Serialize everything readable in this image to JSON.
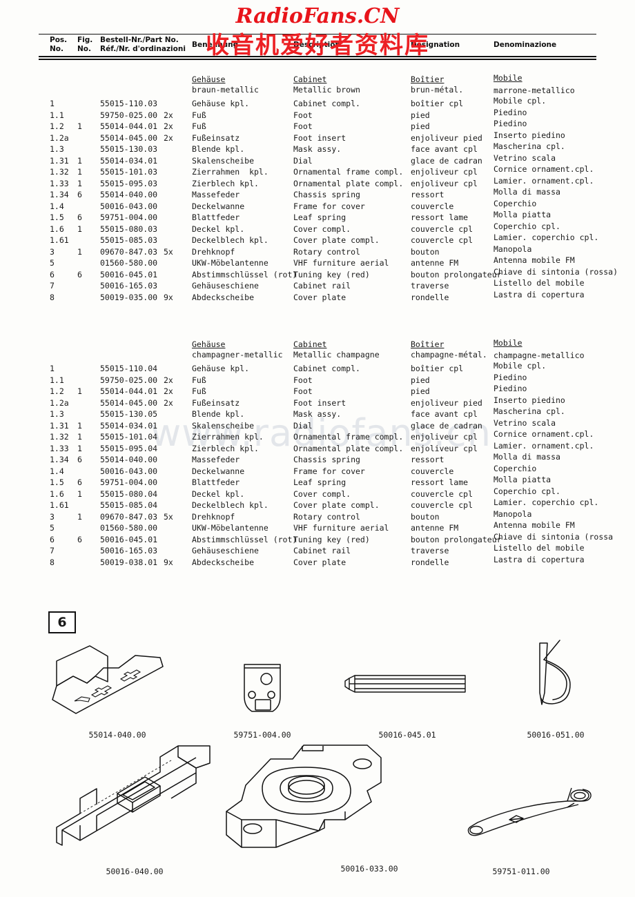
{
  "watermarks": {
    "logo": "RadioFans.CN",
    "logo_cjk": "收音机爱好者资料库",
    "mid": "www.radiofans.cn",
    "logo_color": "#e8141a"
  },
  "header": {
    "pos_l1": "Pos.",
    "pos_l2": "No.",
    "fig_l1": "Fig.",
    "fig_l2": "No.",
    "part_l1": "Bestell-Nr./Part No.",
    "part_l2": "Réf./Nr. d'ordinazioni",
    "de": "Benennung",
    "en": "Description",
    "fr": "Designation",
    "it": "Denominazione"
  },
  "sections": [
    {
      "group": {
        "de_title": "Gehäuse",
        "de_sub": "braun-metallic",
        "en_title": "Cabinet",
        "en_sub": "Metallic brown",
        "fr_title": "Boîtier",
        "fr_sub": "brun-métal.",
        "it_title": "Mobile",
        "it_sub": "marrone-metallico"
      },
      "rows": [
        {
          "pos": "1",
          "fig": "",
          "part": "55015-110.03",
          "qty": "",
          "de": "Gehäuse kpl.",
          "en": "Cabinet compl.",
          "fr": "boîtier cpl",
          "it": "Mobile cpl."
        },
        {
          "pos": "1.1",
          "fig": "",
          "part": "59750-025.00",
          "qty": "2x",
          "de": "Fuß",
          "en": "Foot",
          "fr": "pied",
          "it": "Piedino"
        },
        {
          "pos": "1.2",
          "fig": "1",
          "part": "55014-044.01",
          "qty": "2x",
          "de": "Fuß",
          "en": "Foot",
          "fr": "pied",
          "it": "Piedino"
        },
        {
          "pos": "1.2a",
          "fig": "",
          "part": "55014-045.00",
          "qty": "2x",
          "de": "Fußeinsatz",
          "en": "Foot insert",
          "fr": "enjoliveur pied",
          "it": "Inserto piedino"
        },
        {
          "pos": "1.3",
          "fig": "",
          "part": "55015-130.03",
          "qty": "",
          "de": "Blende kpl.",
          "en": "Mask assy.",
          "fr": "face avant cpl",
          "it": "Mascherina cpl."
        },
        {
          "pos": "1.31",
          "fig": "1",
          "part": "55014-034.01",
          "qty": "",
          "de": "Skalenscheibe",
          "en": "Dial",
          "fr": "glace de cadran",
          "it": "Vetrino scala"
        },
        {
          "pos": "1.32",
          "fig": "1",
          "part": "55015-101.03",
          "qty": "",
          "de": "Zierrahmen  kpl.",
          "en": "Ornamental frame compl.",
          "fr": "enjoliveur cpl",
          "it": "Cornice ornament.cpl."
        },
        {
          "pos": "1.33",
          "fig": "1",
          "part": "55015-095.03",
          "qty": "",
          "de": "Zierblech kpl.",
          "en": "Ornamental plate compl.",
          "fr": "enjoliveur cpl",
          "it": "Lamier. ornament.cpl."
        },
        {
          "pos": "1.34",
          "fig": "6",
          "part": "55014-040.00",
          "qty": "",
          "de": "Massefeder",
          "en": "Chassis spring",
          "fr": "ressort",
          "it": "Molla di massa"
        },
        {
          "pos": "1.4",
          "fig": "",
          "part": "50016-043.00",
          "qty": "",
          "de": "Deckelwanne",
          "en": "Frame for cover",
          "fr": "couvercle",
          "it": "Coperchio"
        },
        {
          "pos": "1.5",
          "fig": "6",
          "part": "59751-004.00",
          "qty": "",
          "de": "Blattfeder",
          "en": "Leaf spring",
          "fr": "ressort lame",
          "it": "Molla piatta"
        },
        {
          "pos": "1.6",
          "fig": "1",
          "part": "55015-080.03",
          "qty": "",
          "de": "Deckel kpl.",
          "en": "Cover compl.",
          "fr": "couvercle cpl",
          "it": "Coperchio cpl."
        },
        {
          "pos": "1.61",
          "fig": "",
          "part": "55015-085.03",
          "qty": "",
          "de": "Deckelblech kpl.",
          "en": "Cover plate compl.",
          "fr": "couvercle cpl",
          "it": "Lamier. coperchio cpl."
        },
        {
          "pos": "3",
          "fig": "1",
          "part": "09670-847.03",
          "qty": "5x",
          "de": "Drehknopf",
          "en": "Rotary control",
          "fr": "bouton",
          "it": "Manopola"
        },
        {
          "pos": "5",
          "fig": "",
          "part": "01560-580.00",
          "qty": "",
          "de": "UKW-Möbelantenne",
          "en": "VHF furniture aerial",
          "fr": "antenne FM",
          "it": "Antenna mobile FM"
        },
        {
          "pos": "6",
          "fig": "6",
          "part": "50016-045.01",
          "qty": "",
          "de": "Abstimmschlüssel (rot)",
          "en": "Tuning key (red)",
          "fr": "bouton prolongateur",
          "it": "Chiave di sintonia (rossa)"
        },
        {
          "pos": "7",
          "fig": "",
          "part": "50016-165.03",
          "qty": "",
          "de": "Gehäuseschiene",
          "en": "Cabinet rail",
          "fr": "traverse",
          "it": "Listello del mobile"
        },
        {
          "pos": "8",
          "fig": "",
          "part": "50019-035.00",
          "qty": "9x",
          "de": "Abdeckscheibe",
          "en": "Cover plate",
          "fr": "rondelle",
          "it": "Lastra di copertura"
        }
      ]
    },
    {
      "group": {
        "de_title": "Gehäuse",
        "de_sub": "champagner-metallic",
        "en_title": "Cabinet",
        "en_sub": "Metallic champagne",
        "fr_title": "Boîtier",
        "fr_sub": "champagne-métal.",
        "it_title": "Mobile",
        "it_sub": "champagne-metallico"
      },
      "rows": [
        {
          "pos": "1",
          "fig": "",
          "part": "55015-110.04",
          "qty": "",
          "de": "Gehäuse kpl.",
          "en": "Cabinet compl.",
          "fr": "boîtier cpl",
          "it": "Mobile cpl."
        },
        {
          "pos": "1.1",
          "fig": "",
          "part": "59750-025.00",
          "qty": "2x",
          "de": "Fuß",
          "en": "Foot",
          "fr": "pied",
          "it": "Piedino"
        },
        {
          "pos": "1.2",
          "fig": "1",
          "part": "55014-044.01",
          "qty": "2x",
          "de": "Fuß",
          "en": "Foot",
          "fr": "pied",
          "it": "Piedino"
        },
        {
          "pos": "1.2a",
          "fig": "",
          "part": "55014-045.00",
          "qty": "2x",
          "de": "Fußeinsatz",
          "en": "Foot insert",
          "fr": "enjoliveur pied",
          "it": "Inserto piedino"
        },
        {
          "pos": "1.3",
          "fig": "",
          "part": "55015-130.05",
          "qty": "",
          "de": "Blende kpl.",
          "en": "Mask assy.",
          "fr": "face avant cpl",
          "it": "Mascherina cpl."
        },
        {
          "pos": "1.31",
          "fig": "1",
          "part": "55014-034.01",
          "qty": "",
          "de": "Skalenscheibe",
          "en": "Dial",
          "fr": "glace de cadran",
          "it": "Vetrino scala"
        },
        {
          "pos": "1.32",
          "fig": "1",
          "part": "55015-101.04",
          "qty": "",
          "de": "Zierrahmen kpl.",
          "en": "Ornamental frame compl.",
          "fr": "enjoliveur cpl",
          "it": "Cornice ornament.cpl."
        },
        {
          "pos": "1.33",
          "fig": "1",
          "part": "55015-095.04",
          "qty": "",
          "de": "Zierblech kpl.",
          "en": "Ornamental plate compl.",
          "fr": "enjoliveur cpl",
          "it": "Lamier. ornament.cpl."
        },
        {
          "pos": "1.34",
          "fig": "6",
          "part": "55014-040.00",
          "qty": "",
          "de": "Massefeder",
          "en": "Chassis spring",
          "fr": "ressort",
          "it": "Molla di massa"
        },
        {
          "pos": "1.4",
          "fig": "",
          "part": "50016-043.00",
          "qty": "",
          "de": "Deckelwanne",
          "en": "Frame for cover",
          "fr": "couvercle",
          "it": "Coperchio"
        },
        {
          "pos": "1.5",
          "fig": "6",
          "part": "59751-004.00",
          "qty": "",
          "de": "Blattfeder",
          "en": "Leaf spring",
          "fr": "ressort lame",
          "it": "Molla piatta"
        },
        {
          "pos": "1.6",
          "fig": "1",
          "part": "55015-080.04",
          "qty": "",
          "de": "Deckel kpl.",
          "en": "Cover compl.",
          "fr": "couvercle cpl",
          "it": "Coperchio cpl."
        },
        {
          "pos": "1.61",
          "fig": "",
          "part": "55015-085.04",
          "qty": "",
          "de": "Deckelblech kpl.",
          "en": "Cover plate compl.",
          "fr": "couvercle cpl",
          "it": "Lamier. coperchio cpl."
        },
        {
          "pos": "3",
          "fig": "1",
          "part": "09670-847.03",
          "qty": "5x",
          "de": "Drehknopf",
          "en": "Rotary control",
          "fr": "bouton",
          "it": "Manopola"
        },
        {
          "pos": "5",
          "fig": "",
          "part": "01560-580.00",
          "qty": "",
          "de": "UKW-Möbelantenne",
          "en": "VHF furniture aerial",
          "fr": "antenne FM",
          "it": "Antenna mobile FM"
        },
        {
          "pos": "6",
          "fig": "6",
          "part": "50016-045.01",
          "qty": "",
          "de": "Abstimmschlüssel (rot)",
          "en": "Tuning key (red)",
          "fr": "bouton prolongateur",
          "it": "Chiave di sintonia (rossa"
        },
        {
          "pos": "7",
          "fig": "",
          "part": "50016-165.03",
          "qty": "",
          "de": "Gehäuseschiene",
          "en": "Cabinet rail",
          "fr": "traverse",
          "it": "Listello del mobile"
        },
        {
          "pos": "8",
          "fig": "",
          "part": "50019-038.01",
          "qty": "9x",
          "de": "Abdeckscheibe",
          "en": "Cover plate",
          "fr": "rondelle",
          "it": "Lastra di copertura"
        }
      ]
    }
  ],
  "figure_plate": {
    "badge": "6",
    "items": [
      {
        "label": "55014-040.00",
        "icon": "chassis-spring-drawing"
      },
      {
        "label": "59751-004.00",
        "icon": "leaf-spring-drawing"
      },
      {
        "label": "50016-045.01",
        "icon": "tuning-key-drawing"
      },
      {
        "label": "50016-051.00",
        "icon": "clip-drawing"
      },
      {
        "label": "50016-040.00",
        "icon": "cabinet-rail-drawing"
      },
      {
        "label": "50016-033.00",
        "icon": "foot-plate-drawing"
      },
      {
        "label": "59751-011.00",
        "icon": "curved-spring-drawing"
      }
    ]
  }
}
